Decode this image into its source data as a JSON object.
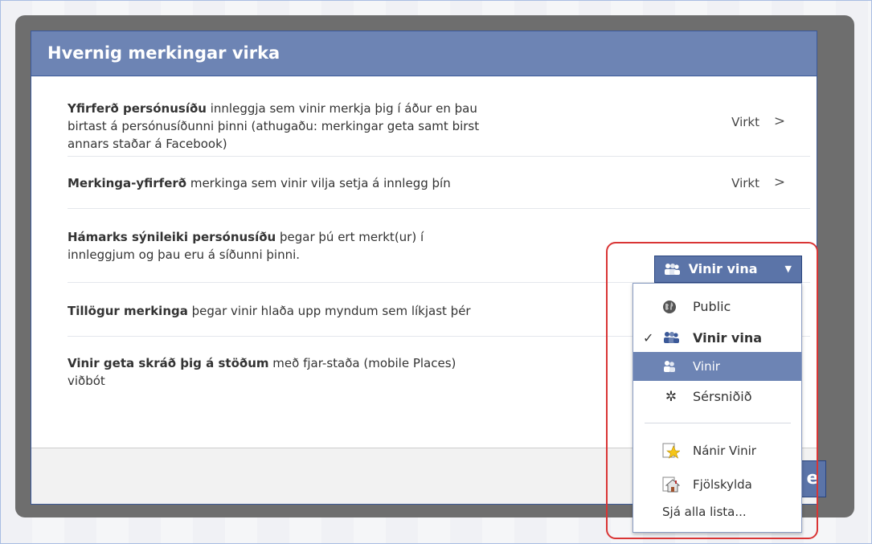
{
  "dialog": {
    "title": "Hvernig merkingar virka",
    "rows": [
      {
        "bold": "Yfirferð persónusíðu",
        "line1": " innleggja sem vinir merkja þig í áður en þau",
        "line2": "birtast á persónusíðunni þinni (athugaðu: merkingar geta samt birst",
        "line3": "annars staðar á Facebook)",
        "value": "Virkt",
        "chevron": ">"
      },
      {
        "bold": "Merkinga-yfirferð",
        "line1": " merkinga sem vinir vilja setja á innlegg þín",
        "value": "Virkt",
        "chevron": ">"
      },
      {
        "bold": "Hámarks sýnileiki persónusíðu",
        "line1": " þegar þú ert merkt(ur) í",
        "line2": "innleggjum og þau eru á síðunni þinni."
      },
      {
        "bold": "Tillögur merkinga",
        "line1": " þegar vinir hlaða upp myndum sem líkjast þér"
      },
      {
        "bold": "Vinir geta skráð þig á stöðum",
        "line1": " með fjar-staða (mobile Places)",
        "line2": "viðbót"
      }
    ],
    "close_peek": "e"
  },
  "audience_button": {
    "label": "Vinir vina",
    "caret": "▼"
  },
  "menu": {
    "items": [
      {
        "label": "Public",
        "icon": "globe-icon"
      },
      {
        "label": "Vinir vina",
        "icon": "friends-of-friends-icon",
        "check": "✓"
      },
      {
        "label": "Vinir",
        "icon": "friends-icon"
      },
      {
        "label": "Sérsniðið",
        "icon": "gear-icon",
        "glyph": "✲"
      },
      {
        "label": "Nánir Vinir",
        "icon": "star-list-icon"
      },
      {
        "label": "Fjölskylda",
        "icon": "house-icon"
      },
      {
        "label": "Sjá alla lista..."
      }
    ]
  },
  "colors": {
    "header": "#6d84b4",
    "selected": "#6d84b4",
    "highlight_box": "#d93535",
    "button": "#5b74a8"
  }
}
